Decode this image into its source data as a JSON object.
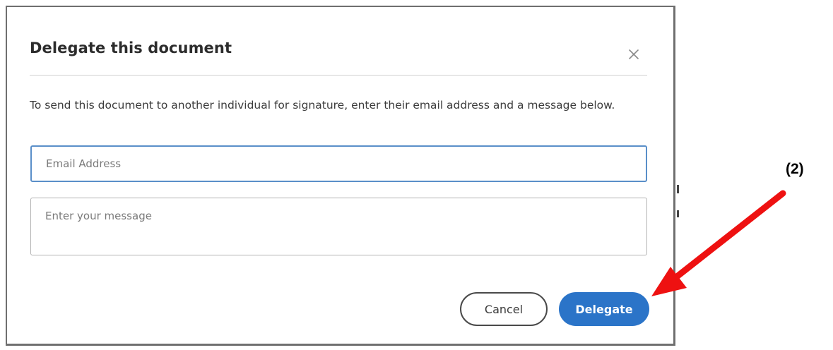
{
  "dialog": {
    "title": "Delegate this document",
    "close_icon": "close-icon",
    "description": "To send this document to another individual for signature, enter their email address and a message below.",
    "email_placeholder": "Email Address",
    "email_value": "",
    "message_placeholder": "Enter your message",
    "message_value": "",
    "cancel_label": "Cancel",
    "delegate_label": "Delegate"
  },
  "annotation": {
    "step_label": "(2)",
    "arrow_icon": "arrow-icon"
  },
  "colors": {
    "primary_button": "#2b74c8",
    "focus_border": "#5a8fc9",
    "annotation_arrow": "#ee1111"
  }
}
